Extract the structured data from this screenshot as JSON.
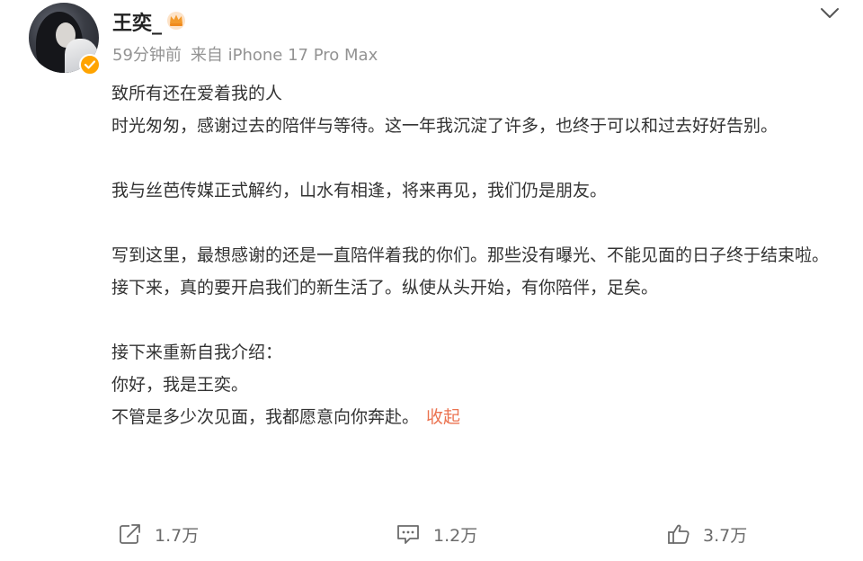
{
  "post": {
    "username": "王奕_",
    "time": "59分钟前",
    "source": "来自 iPhone 17 Pro Max",
    "lines": [
      "致所有还在爱着我的人",
      "时光匆匆，感谢过去的陪伴与等待。这一年我沉淀了许多，也终于可以和过去好好告别。",
      "",
      "我与丝芭传媒正式解约，山水有相逢，将来再见，我们仍是朋友。",
      "",
      "写到这里，最想感谢的还是一直陪伴着我的你们。那些没有曝光、不能见面的日子终于结束啦。",
      "接下来，真的要开启我们的新生活了。纵使从头开始，有你陪伴，足矣。",
      "",
      "接下来重新自我介绍：",
      "你好，我是王奕。",
      "不管是多少次见面，我都愿意向你奔赴。"
    ],
    "collapse_label": "收起"
  },
  "actions": {
    "repost_count": "1.7万",
    "comment_count": "1.2万",
    "like_count": "3.7万"
  },
  "icons": {
    "avatar": "avatar-photo",
    "verified": "verified-badge-icon",
    "crown": "crown-icon",
    "menu": "chevron-down-icon",
    "repost": "repost-icon",
    "comment": "comment-icon",
    "like": "thumbs-up-icon"
  },
  "colors": {
    "text": "#333333",
    "meta": "#939393",
    "accent": "#eb7350",
    "badge": "#ffa400"
  }
}
